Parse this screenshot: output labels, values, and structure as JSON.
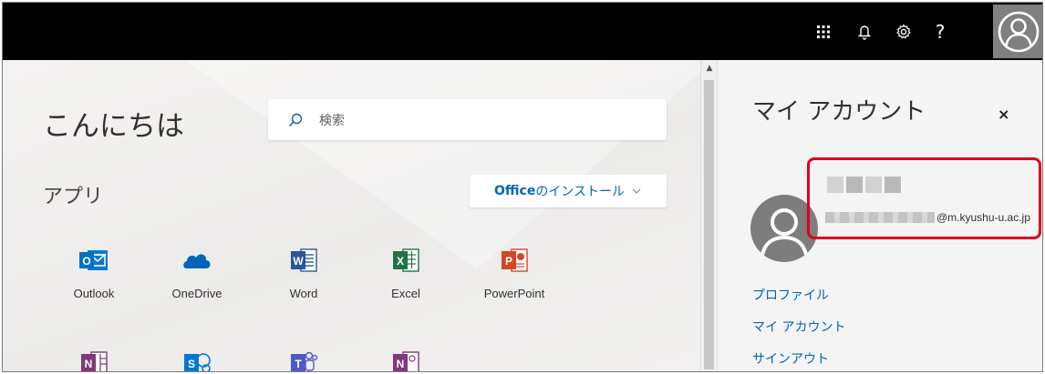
{
  "topbar": {
    "icons": [
      "app-launcher-icon",
      "bell-icon",
      "gear-icon",
      "help-icon",
      "user-avatar-icon"
    ],
    "help_label": "?"
  },
  "main": {
    "greeting": "こんにちは",
    "search": {
      "placeholder": "検索"
    },
    "apps_title": "アプリ",
    "install": {
      "brand": "Office",
      "label": " のインストール"
    },
    "apps": [
      {
        "label": "Outlook",
        "color": "#0072c6",
        "letter": "O"
      },
      {
        "label": "OneDrive",
        "color": "#0364b8",
        "letter": ""
      },
      {
        "label": "Word",
        "color": "#2b579a",
        "letter": "W"
      },
      {
        "label": "Excel",
        "color": "#217346",
        "letter": "X"
      },
      {
        "label": "PowerPoint",
        "color": "#d24726",
        "letter": "P"
      }
    ],
    "apps_row2": [
      {
        "color": "#80397b",
        "letter": "N"
      },
      {
        "color": "#0078d4",
        "letter": "S"
      },
      {
        "color": "#5059c9",
        "letter": "T"
      },
      {
        "color": "#80397b",
        "letter": "N"
      }
    ]
  },
  "panel": {
    "title": "マイ アカウント",
    "close_label": "×",
    "email_domain": "@m.kyushu-u.ac.jp",
    "links": [
      "プロファイル",
      "マイ アカウント",
      "サインアウト"
    ],
    "highlight_color": "#e0001b"
  }
}
